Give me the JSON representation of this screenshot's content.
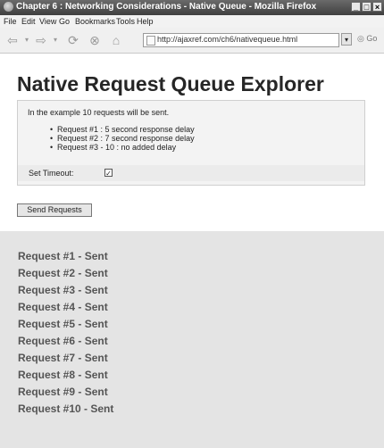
{
  "window": {
    "title": "Chapter 6 : Networking Considerations - Native Queue - Mozilla Firefox",
    "controls": [
      "_",
      "□",
      "×"
    ]
  },
  "menu": [
    "File",
    "Edit",
    "View",
    "Go",
    "Bookmarks",
    "Tools",
    "Help"
  ],
  "navbar": {
    "url": "http://ajaxref.com/ch6/nativequeue.html",
    "go_label": "Go"
  },
  "page": {
    "heading": "Native Request Queue Explorer",
    "intro": "In the example 10 requests will be sent.",
    "list": [
      "Request #1 : 5 second response delay",
      "Request #2 : 7 second response delay",
      "Request #3 - 10 : no added delay"
    ],
    "timeout_label": "Set Timeout:",
    "timeout_checked": true,
    "send_button": "Send Requests"
  },
  "results": [
    "Request #1 - Sent",
    "Request #2 - Sent",
    "Request #3 - Sent",
    "Request #4 - Sent",
    "Request #5 - Sent",
    "Request #6 - Sent",
    "Request #7 - Sent",
    "Request #8 - Sent",
    "Request #9 - Sent",
    "Request #10 - Sent"
  ]
}
